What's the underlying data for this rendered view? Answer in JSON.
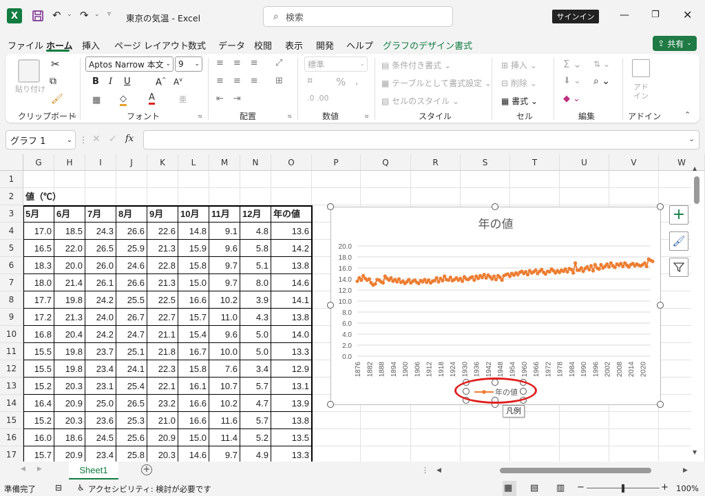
{
  "titlebar": {
    "title": "東京の気温  -  Excel",
    "search_placeholder": "検索",
    "signin": "サインイン"
  },
  "menu": [
    "ファイル",
    "ホーム",
    "挿入",
    "ページ レイアウト",
    "数式",
    "データ",
    "校閲",
    "表示",
    "開発",
    "ヘルプ",
    "グラフのデザイン",
    "書式"
  ],
  "share_label": "共有",
  "ribbon": {
    "clipboard": {
      "paste": "貼り付け",
      "label": "クリップボード"
    },
    "font": {
      "name": "Aptos Narrow 本文",
      "size": "9",
      "label": "フォント"
    },
    "alignment": {
      "label": "配置"
    },
    "number": {
      "format": "標準",
      "label": "数値"
    },
    "styles": {
      "conditional": "条件付き書式",
      "table": "テーブルとして書式設定",
      "cell": "セルのスタイル",
      "label": "スタイル"
    },
    "cells": {
      "insert": "挿入",
      "delete": "削除",
      "format": "書式",
      "label": "セル"
    },
    "editing": {
      "label": "編集"
    },
    "addins": {
      "button": "アド\nイン",
      "label": "アドイン"
    }
  },
  "namebox": "グラフ 1",
  "fx": "fx",
  "columns": [
    "G",
    "H",
    "I",
    "J",
    "K",
    "L",
    "M",
    "N",
    "O",
    "P",
    "Q",
    "R",
    "S",
    "T",
    "U",
    "V",
    "W"
  ],
  "rows": [
    "1",
    "2",
    "3",
    "4",
    "5",
    "6",
    "7",
    "8",
    "9",
    "10",
    "11",
    "12",
    "13",
    "14",
    "15",
    "16",
    "17"
  ],
  "table": {
    "title_cell": "値（℃）",
    "headers": [
      "5月",
      "6月",
      "7月",
      "8月",
      "9月",
      "10月",
      "11月",
      "12月",
      "年の値"
    ],
    "data": [
      [
        "17.0",
        "18.5",
        "24.3",
        "26.6",
        "22.6",
        "14.8",
        "9.1",
        "4.8",
        "13.6"
      ],
      [
        "16.5",
        "22.0",
        "26.5",
        "25.9",
        "21.3",
        "15.9",
        "9.6",
        "5.8",
        "14.2"
      ],
      [
        "18.3",
        "20.0",
        "26.0",
        "24.6",
        "22.8",
        "15.8",
        "9.7",
        "5.1",
        "13.8"
      ],
      [
        "18.0",
        "21.4",
        "26.1",
        "26.6",
        "21.3",
        "15.0",
        "9.7",
        "8.0",
        "14.6"
      ],
      [
        "17.7",
        "19.8",
        "24.2",
        "25.5",
        "22.5",
        "16.6",
        "10.2",
        "3.9",
        "14.1"
      ],
      [
        "17.2",
        "21.3",
        "24.0",
        "26.7",
        "22.7",
        "15.7",
        "11.0",
        "4.3",
        "13.8"
      ],
      [
        "16.8",
        "20.4",
        "24.2",
        "24.7",
        "21.1",
        "15.4",
        "9.6",
        "5.0",
        "14.0"
      ],
      [
        "15.5",
        "19.8",
        "23.7",
        "25.1",
        "21.8",
        "16.7",
        "10.0",
        "5.0",
        "13.3"
      ],
      [
        "15.5",
        "19.8",
        "23.4",
        "24.1",
        "22.3",
        "15.8",
        "7.6",
        "3.4",
        "12.9"
      ],
      [
        "15.2",
        "20.3",
        "23.1",
        "25.4",
        "22.1",
        "16.1",
        "10.7",
        "5.7",
        "13.1"
      ],
      [
        "16.4",
        "20.9",
        "25.0",
        "26.5",
        "23.2",
        "16.6",
        "10.2",
        "4.7",
        "13.9"
      ],
      [
        "15.2",
        "20.3",
        "23.6",
        "25.3",
        "21.0",
        "16.6",
        "11.6",
        "5.7",
        "13.8"
      ],
      [
        "16.0",
        "18.6",
        "24.5",
        "25.6",
        "20.9",
        "15.0",
        "11.4",
        "5.2",
        "13.5"
      ],
      [
        "15.7",
        "20.9",
        "23.4",
        "25.8",
        "20.3",
        "14.6",
        "9.7",
        "4.9",
        "13.3"
      ]
    ]
  },
  "chart_data": {
    "type": "line",
    "title": "年の値",
    "x_tick_labels": [
      "1876",
      "1882",
      "1888",
      "1894",
      "1900",
      "1906",
      "1912",
      "1918",
      "1924",
      "1930",
      "1936",
      "1942",
      "1948",
      "1954",
      "1960",
      "1966",
      "1972",
      "1978",
      "1984",
      "1990",
      "1996",
      "2002",
      "2008",
      "2014",
      "2020"
    ],
    "y_tick_labels": [
      "0.0",
      "2.0",
      "4.0",
      "6.0",
      "8.0",
      "10.0",
      "12.0",
      "14.0",
      "16.0",
      "18.0",
      "20.0"
    ],
    "ylim": [
      0,
      20
    ],
    "xlim": [
      1876,
      2024
    ],
    "legend_entry": "年の値",
    "series": [
      {
        "name": "年の値",
        "color": "#ed7d31",
        "x_start": 1876,
        "values": [
          13.6,
          14.2,
          13.8,
          14.6,
          14.1,
          13.8,
          14.0,
          13.3,
          12.9,
          13.1,
          13.9,
          13.8,
          13.5,
          13.3,
          14.5,
          14.1,
          13.8,
          14.2,
          13.6,
          13.9,
          13.5,
          14.0,
          13.4,
          13.6,
          13.2,
          13.5,
          13.9,
          13.3,
          13.6,
          13.8,
          13.4,
          13.2,
          13.7,
          13.5,
          13.9,
          13.4,
          13.8,
          13.3,
          13.6,
          13.7,
          14.2,
          13.5,
          14.1,
          13.7,
          14.5,
          13.9,
          13.8,
          14.3,
          13.7,
          13.9,
          14.2,
          13.8,
          14.1,
          13.6,
          14.4,
          14.0,
          13.9,
          14.2,
          14.4,
          13.8,
          14.5,
          14.1,
          14.6,
          14.3,
          14.8,
          14.2,
          14.7,
          14.4,
          14.0,
          14.5,
          13.9,
          14.6,
          14.3,
          13.8,
          14.6,
          14.8,
          14.9,
          14.5,
          15.0,
          14.7,
          15.1,
          14.8,
          15.2,
          15.4,
          15.0,
          15.3,
          14.8,
          15.5,
          15.1,
          15.3,
          15.6,
          15.0,
          15.4,
          15.7,
          15.2,
          14.9,
          15.4,
          15.3,
          15.8,
          15.5,
          15.1,
          15.5,
          15.2,
          15.6,
          15.4,
          15.8,
          15.3,
          15.9,
          15.7,
          15.1,
          16.9,
          15.6,
          15.6,
          16.0,
          15.4,
          15.9,
          16.2,
          15.7,
          16.4,
          15.5,
          16.6,
          16.0,
          15.8,
          16.6,
          16.0,
          16.3,
          16.7,
          16.2,
          16.9,
          16.4,
          16.1,
          16.7,
          16.5,
          16.8,
          16.3,
          16.9,
          16.5,
          16.2,
          16.6,
          16.8,
          16.4,
          16.7,
          16.5,
          16.4,
          16.6,
          16.9,
          16.3,
          17.6,
          17.4,
          17.2
        ]
      }
    ]
  },
  "chart_tooltip": "凡例",
  "sheet_tab": "Sheet1",
  "status": {
    "ready": "準備完了",
    "accessibility": "アクセシビリティ: 検討が必要です",
    "zoom": "100%"
  }
}
